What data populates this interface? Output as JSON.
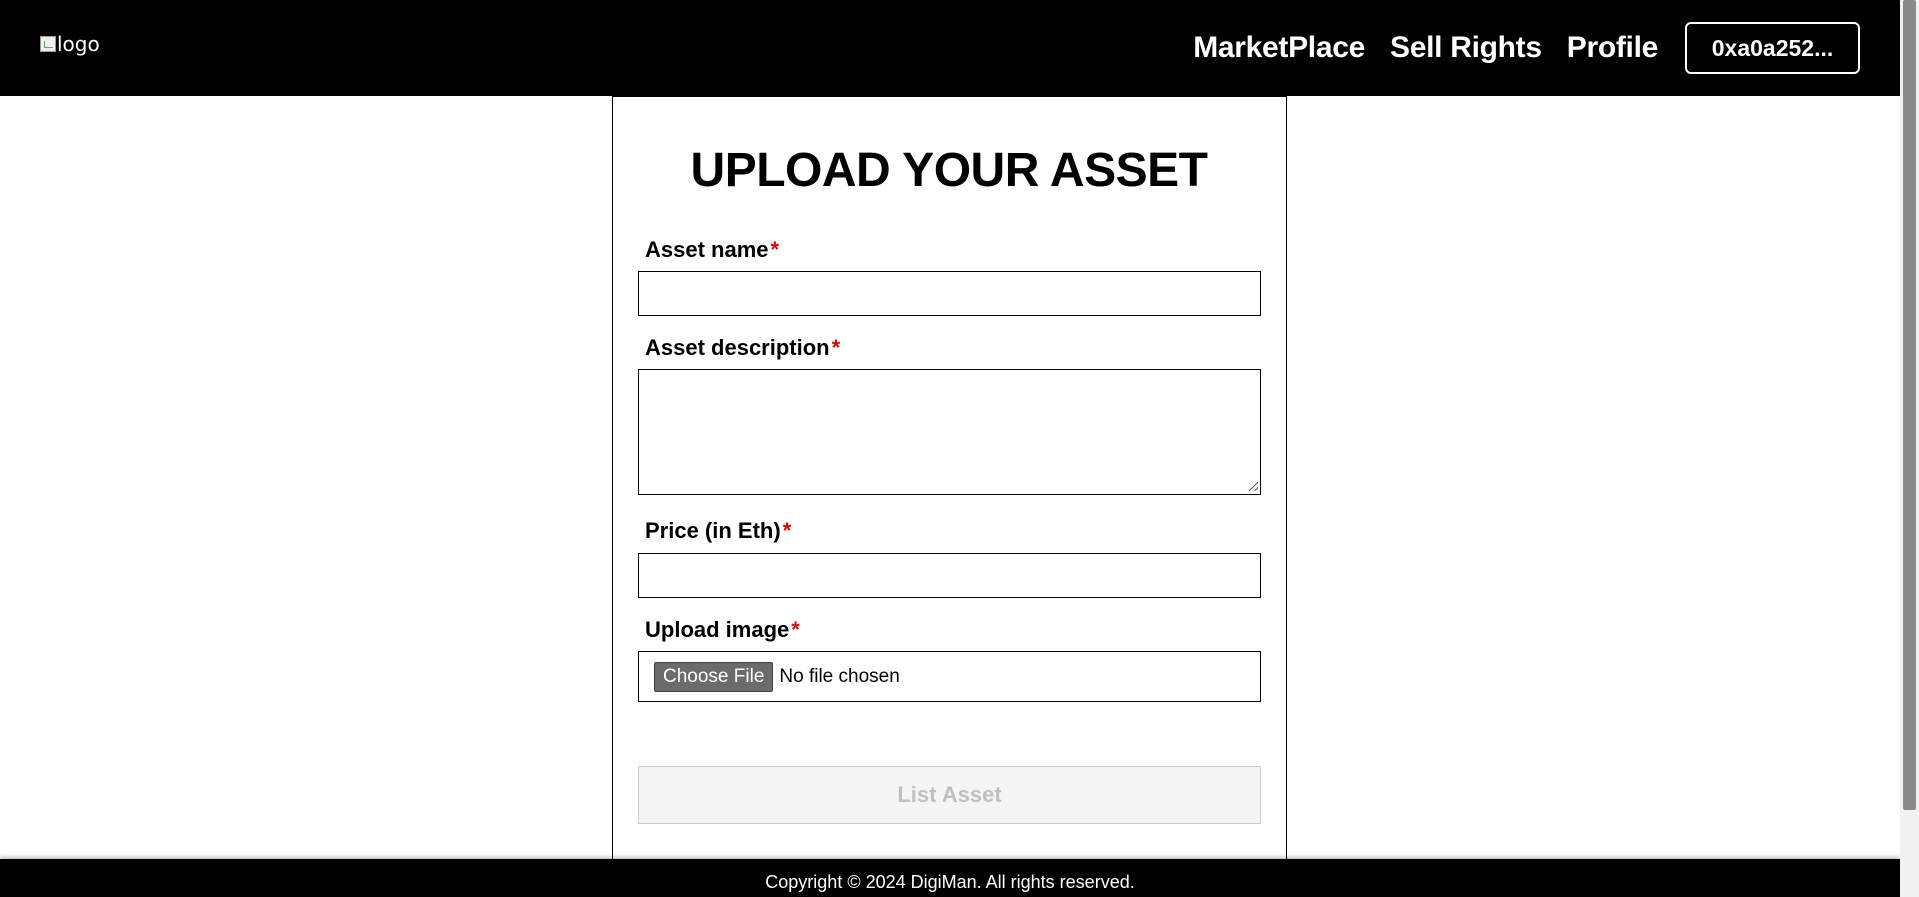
{
  "header": {
    "logo_alt": "logo",
    "nav": {
      "marketplace": "MarketPlace",
      "sell_rights": "Sell Rights",
      "profile": "Profile"
    },
    "wallet_address": "0xa0a252..."
  },
  "form": {
    "title": "UPLOAD YOUR ASSET",
    "required_marker": "*",
    "fields": {
      "asset_name": {
        "label": "Asset name",
        "value": ""
      },
      "asset_description": {
        "label": "Asset description",
        "value": ""
      },
      "price": {
        "label": "Price (in Eth)",
        "value": ""
      },
      "upload_image": {
        "label": "Upload image",
        "button_label": "Choose File",
        "status": "No file chosen"
      }
    },
    "submit_label": "List Asset"
  },
  "footer": {
    "copyright": "Copyright © 2024 DigiMan. All rights reserved."
  },
  "colors": {
    "header_bg": "#000000",
    "required": "#e00000",
    "disabled_button_bg": "#f5f5f5",
    "disabled_button_text": "#c0c0c0"
  }
}
